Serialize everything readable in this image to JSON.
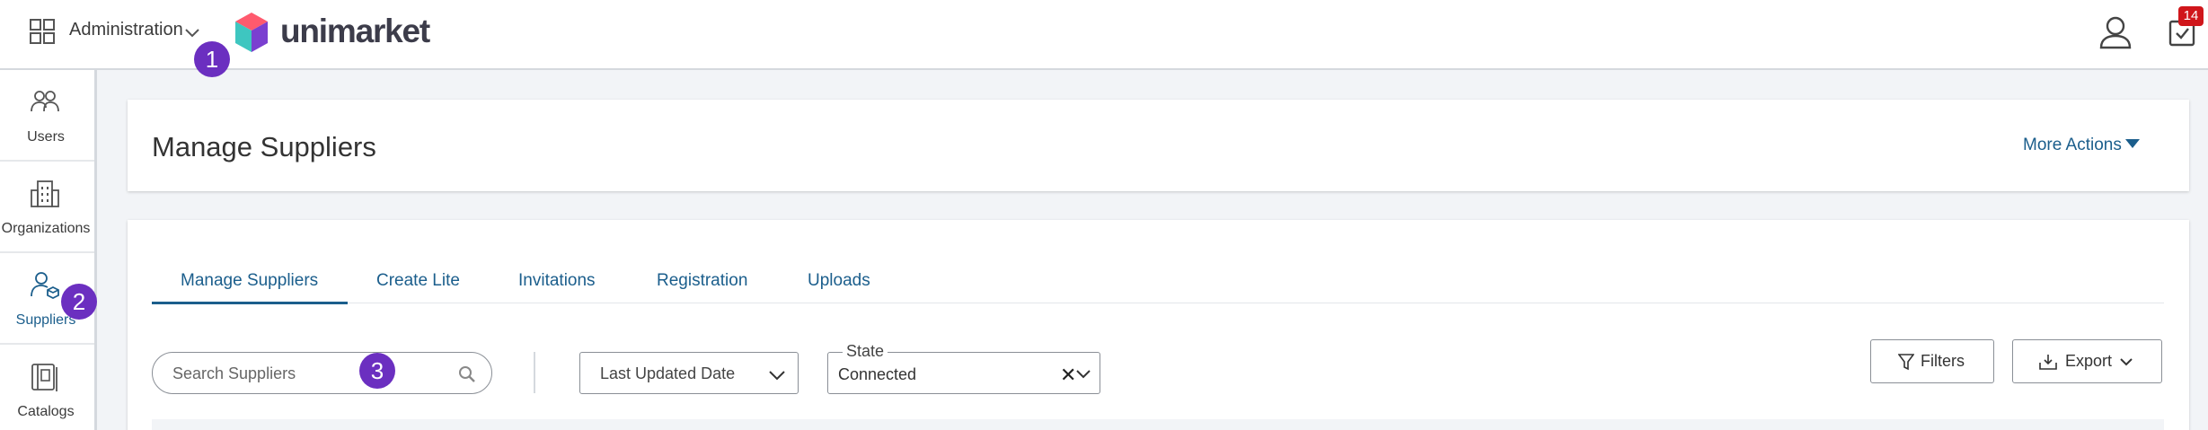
{
  "header": {
    "app_switcher_label": "Administration",
    "logo_text": "unimarket",
    "inbox_badge": "14"
  },
  "sidebar": {
    "items": [
      {
        "label": "Users",
        "icon": "users-icon",
        "active": false
      },
      {
        "label": "Organizations",
        "icon": "building-icon",
        "active": false
      },
      {
        "label": "Suppliers",
        "icon": "supplier-icon",
        "active": true
      },
      {
        "label": "Catalogs",
        "icon": "catalog-icon",
        "active": false
      }
    ]
  },
  "steps": [
    "1",
    "2",
    "3"
  ],
  "page": {
    "title": "Manage Suppliers",
    "more_actions": "More Actions"
  },
  "tabs": [
    {
      "label": "Manage Suppliers",
      "active": true
    },
    {
      "label": "Create Lite",
      "active": false
    },
    {
      "label": "Invitations",
      "active": false
    },
    {
      "label": "Registration",
      "active": false
    },
    {
      "label": "Uploads",
      "active": false
    }
  ],
  "toolbar": {
    "search_placeholder": "Search Suppliers",
    "sort_label": "Last Updated Date",
    "state_legend": "State",
    "state_value": "Connected",
    "filters_label": "Filters",
    "export_label": "Export"
  },
  "colors": {
    "accent": "#1b5e8c",
    "step_marker": "#6b2fc0",
    "badge": "#d0161b"
  }
}
